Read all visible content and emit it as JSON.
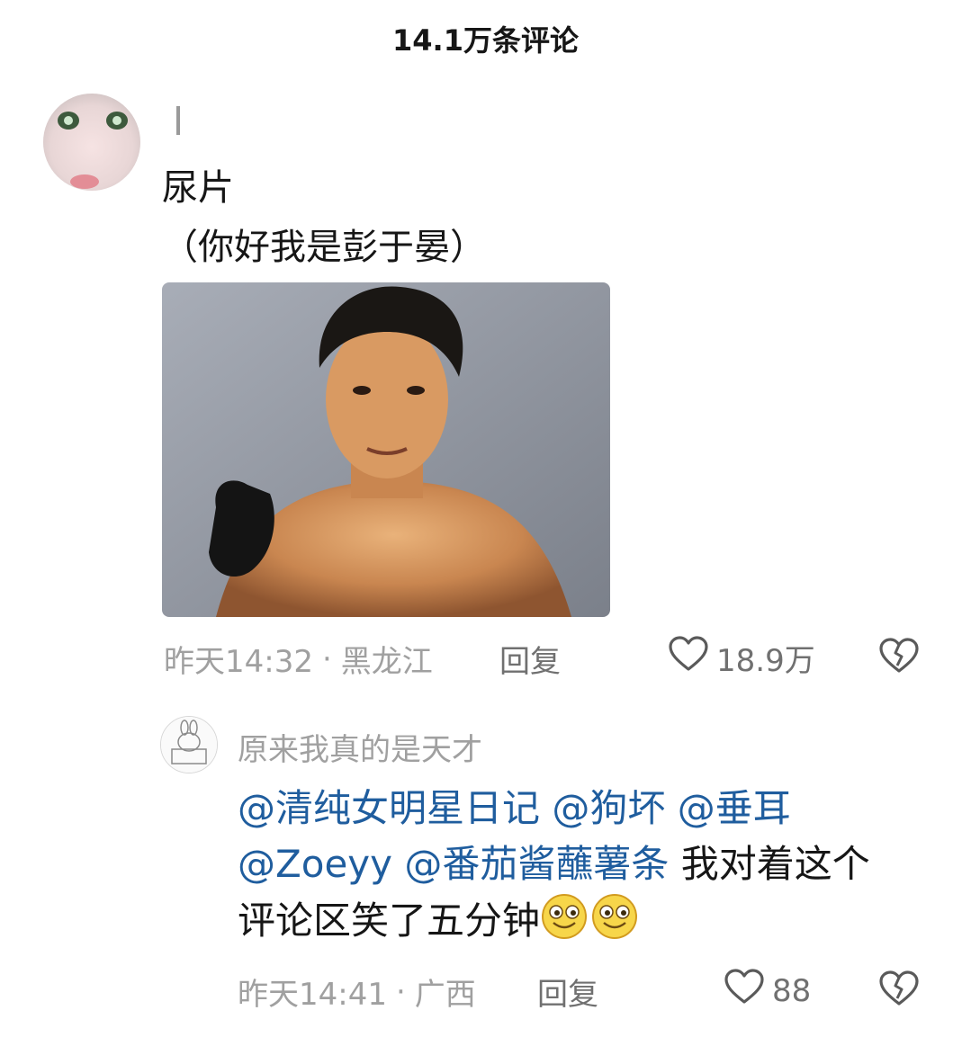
{
  "header": {
    "title": "14.1万条评论"
  },
  "comment": {
    "username": "|",
    "text_line1": "尿片",
    "text_line2": "（你好我是彭于晏）",
    "time": "昨天14:32",
    "sep": "·",
    "location": "黑龙江",
    "reply_label": "回复",
    "likes": "18.9万"
  },
  "reply": {
    "username": "原来我真的是天才",
    "mentions": [
      "@清纯女明星日记",
      "@狗坏",
      "@垂耳",
      "@Zoeyy",
      "@番茄酱蘸薯条"
    ],
    "text_after": "我对着这个",
    "text_line3": "评论区笑了五分钟",
    "time": "昨天14:41",
    "sep": "·",
    "location": "广西",
    "reply_label": "回复",
    "likes": "88"
  },
  "colors": {
    "mention": "#1f5d9e",
    "meta": "#a0a0a0",
    "text": "#161616"
  },
  "icons": [
    "heart-outline-icon",
    "broken-heart-icon",
    "smile-emoji-icon"
  ]
}
